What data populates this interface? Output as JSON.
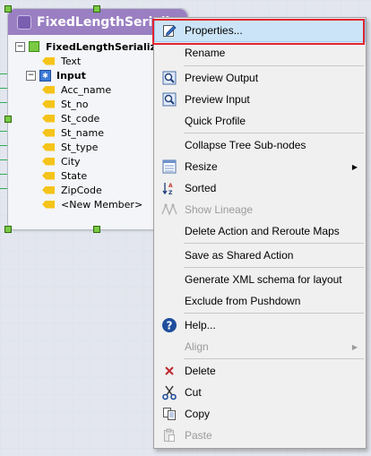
{
  "node": {
    "title": "FixedLengthSerializ",
    "tree": [
      {
        "label": "FixedLengthSerializer",
        "icon": "green-square-icon",
        "expander": "−"
      },
      {
        "label": "Text",
        "icon": "field-tag-icon"
      },
      {
        "label": "Input",
        "icon": "input-table-icon",
        "expander": "−"
      },
      {
        "label": "Acc_name",
        "icon": "field-tag-icon"
      },
      {
        "label": "St_no",
        "icon": "field-tag-icon"
      },
      {
        "label": "St_code",
        "icon": "field-tag-icon"
      },
      {
        "label": "St_name",
        "icon": "field-tag-icon"
      },
      {
        "label": "St_type",
        "icon": "field-tag-icon"
      },
      {
        "label": "City",
        "icon": "field-tag-icon"
      },
      {
        "label": "State",
        "icon": "field-tag-icon"
      },
      {
        "label": "ZipCode",
        "icon": "field-tag-icon"
      },
      {
        "label": "<New Member>",
        "icon": "field-tag-icon"
      }
    ]
  },
  "menu": {
    "items": [
      {
        "label": "Properties...",
        "icon": "edit-properties-icon",
        "highlighted": true
      },
      {
        "label": "Rename"
      },
      {
        "label": "Preview Output",
        "icon": "magnifier-icon"
      },
      {
        "label": "Preview Input",
        "icon": "magnifier-icon"
      },
      {
        "label": "Quick Profile"
      },
      {
        "label": "Collapse Tree Sub-nodes"
      },
      {
        "label": "Resize",
        "icon": "resize-grid-icon",
        "submenu": true
      },
      {
        "label": "Sorted",
        "icon": "sort-az-icon"
      },
      {
        "label": "Show Lineage",
        "icon": "lineage-icon",
        "disabled": true
      },
      {
        "label": "Delete Action and Reroute Maps"
      },
      {
        "label": "Save as Shared Action"
      },
      {
        "label": "Generate XML schema for layout"
      },
      {
        "label": "Exclude from Pushdown"
      },
      {
        "label": "Help...",
        "icon": "help-icon"
      },
      {
        "label": "Align",
        "disabled": true,
        "submenu": true
      },
      {
        "label": "Delete",
        "icon": "delete-x-icon"
      },
      {
        "label": "Cut",
        "icon": "scissors-icon"
      },
      {
        "label": "Copy",
        "icon": "copy-icon"
      },
      {
        "label": "Paste",
        "icon": "paste-icon",
        "disabled": true
      }
    ]
  },
  "colors": {
    "header": "#9a7fc2",
    "highlight": "#cce4f7",
    "focus_box": "#e0252f",
    "handle": "#7ac943"
  }
}
